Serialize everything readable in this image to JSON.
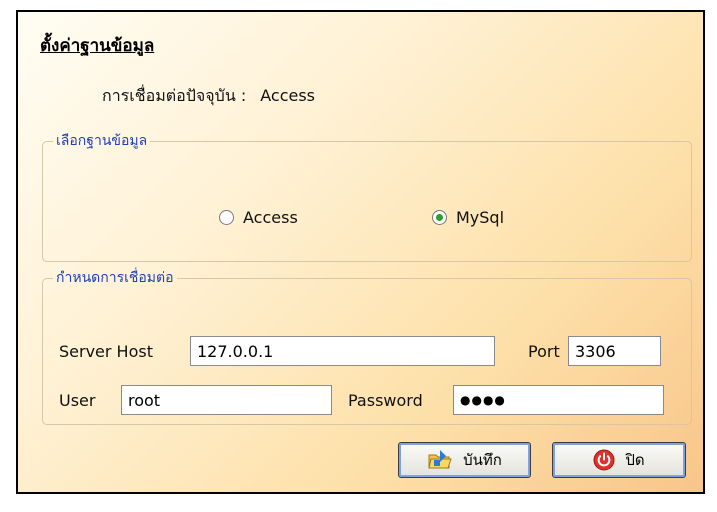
{
  "dialog": {
    "title": "ตั้งค่าฐานข้อมูล",
    "current_connection_label": "การเชื่อมต่อปัจจุบัน :",
    "current_connection_value": "Access"
  },
  "database_group": {
    "legend": "เลือกฐานข้อมูล",
    "options": [
      {
        "label": "Access",
        "selected": false
      },
      {
        "label": "MySql",
        "selected": true
      }
    ]
  },
  "connection_group": {
    "legend": "กำหนดการเชื่อมต่อ",
    "server_host_label": "Server Host",
    "server_host_value": "127.0.0.1",
    "port_label": "Port",
    "port_value": "3306",
    "user_label": "User",
    "user_value": "root",
    "password_label": "Password",
    "password_mask": "●●●●"
  },
  "buttons": {
    "save_label": "บันทึก",
    "close_label": "ปิด"
  },
  "colors": {
    "legend": "#1f3fb8",
    "radio_checked": "#2e9e2e",
    "close_icon": "#e0302a",
    "button_focus": "#7ea2e0"
  },
  "icons": {
    "save": "save-folder-icon",
    "close": "power-icon"
  }
}
